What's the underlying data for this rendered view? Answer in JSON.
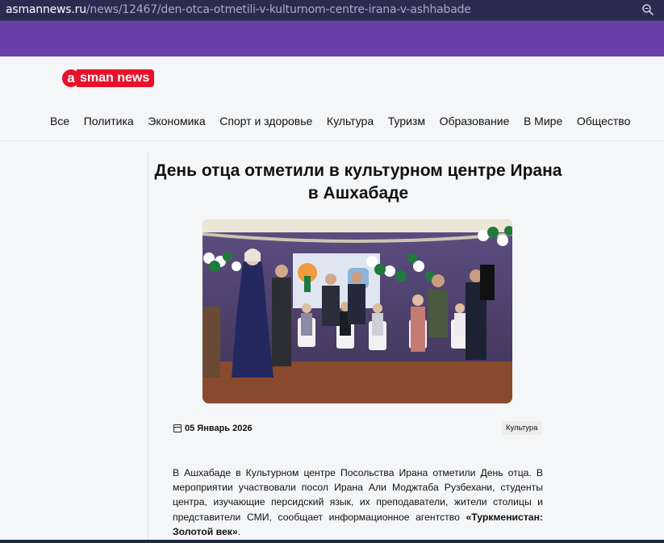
{
  "browser": {
    "url_domain": "asmannews.ru",
    "url_path": "/news/12467/den-otca-otmetili-v-kulturnom-centre-irana-v-ashhabade",
    "zoom_icon": "zoom-icon"
  },
  "site": {
    "logo_letter": "a",
    "logo_text": "sman news",
    "brand_color": "#e8102a",
    "accent_color": "#6a3fa8"
  },
  "nav": {
    "items": [
      "Все",
      "Политика",
      "Экономика",
      "Спорт и здоровье",
      "Культура",
      "Туризм",
      "Образование",
      "В Мире",
      "Общество"
    ]
  },
  "article": {
    "title": "День отца отметили в культурном центре Ирана в Ашхабаде",
    "date": "05 Январь 2026",
    "category": "Культура",
    "body_plain": "В Ашхабаде в Культурном центре Посольства Ирана отметили День отца. В мероприятии участвовали посол Ирана Али Моджтаба Рузбехани, студенты центра, изучающие персидский язык, их преподаватели, жители столицы и представители СМИ, сообщает информационное агентство ",
    "body_bold": "«Туркменистан: Золотой век»",
    "body_end": "."
  }
}
